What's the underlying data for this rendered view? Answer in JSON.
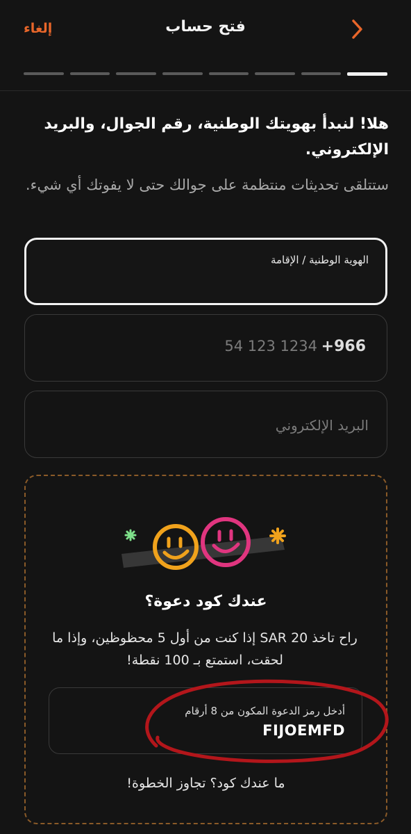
{
  "header": {
    "title": "فتح حساب",
    "cancel_label": "إلغاء",
    "steps_total": 8,
    "steps_current": 1
  },
  "intro": {
    "headline": "هلا! لنبدأ بهويتك الوطنية، رقم الجوال، والبريد الإلكتروني.",
    "subtitle": "ستتلقى تحديثات منتظمة على جوالك حتى لا يفوتك أي شيء."
  },
  "form": {
    "id_label": "الهوية الوطنية / الإقامة",
    "phone_prefix": "+966",
    "phone_placeholder": "54 123 1234",
    "email_placeholder": "البريد الإلكتروني"
  },
  "invite": {
    "title": "عندك كود دعوة؟",
    "description": "راح تاخذ 20 SAR إذا كنت من أول 5 محظوظين، وإذا ما لحقت، استمتع بـ 100 نقطة!",
    "code_label": "أدخل رمز الدعوة المكون من 8 أرقام",
    "code_value": "FIJOEMFD",
    "skip_label": "ما عندك كود؟ تجاوز الخطوة!"
  },
  "colors": {
    "accent": "#e8662a",
    "smiley_orange": "#f0a21c",
    "smiley_pink": "#e0357f",
    "sparkle_green": "#7ee08a",
    "annotation_red": "#b3161b"
  }
}
